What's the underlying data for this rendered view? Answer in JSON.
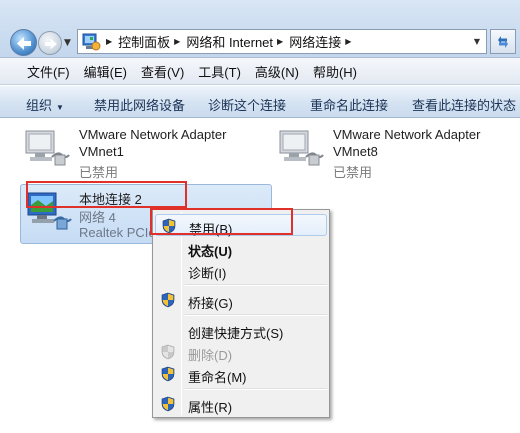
{
  "address_bar": {
    "breadcrumbs": [
      "控制面板",
      "网络和 Internet",
      "网络连接"
    ],
    "location_icon": "control-panel-icon",
    "refresh_icon": "refresh-icon"
  },
  "menu_bar": {
    "items": [
      "文件(F)",
      "编辑(E)",
      "查看(V)",
      "工具(T)",
      "高级(N)",
      "帮助(H)"
    ]
  },
  "command_bar": {
    "organize": "组织",
    "disable_device": "禁用此网络设备",
    "diagnose": "诊断这个连接",
    "rename": "重命名此连接",
    "view_status": "查看此连接的状态"
  },
  "connections": [
    {
      "name": "VMware Network Adapter",
      "sub": "VMnet1",
      "status": "已禁用",
      "icon": "network-adapter-disabled-icon"
    },
    {
      "name": "VMware Network Adapter",
      "sub": "VMnet8",
      "status": "已禁用",
      "icon": "network-adapter-disabled-icon"
    },
    {
      "name": "本地连接 2",
      "sub": "网络  4",
      "status": "Realtek PCIe",
      "icon": "network-adapter-connected-icon"
    }
  ],
  "context_menu": {
    "items": [
      {
        "label": "禁用(B)",
        "icon": "uac-shield-icon",
        "state": "hover"
      },
      {
        "label": "状态(U)",
        "icon": "",
        "state": "default-bold"
      },
      {
        "label": "诊断(I)",
        "icon": "",
        "state": "normal"
      },
      {
        "label": "桥接(G)",
        "icon": "uac-shield-icon",
        "state": "normal"
      },
      {
        "label": "创建快捷方式(S)",
        "icon": "",
        "state": "normal"
      },
      {
        "label": "删除(D)",
        "icon": "uac-shield-icon",
        "state": "disabled"
      },
      {
        "label": "重命名(M)",
        "icon": "uac-shield-icon",
        "state": "normal"
      },
      {
        "label": "属性(R)",
        "icon": "uac-shield-icon",
        "state": "normal"
      }
    ]
  },
  "colors": {
    "highlight_box": "#e0302a",
    "selection": "#c6dcf4",
    "command_text": "#1b3356"
  }
}
